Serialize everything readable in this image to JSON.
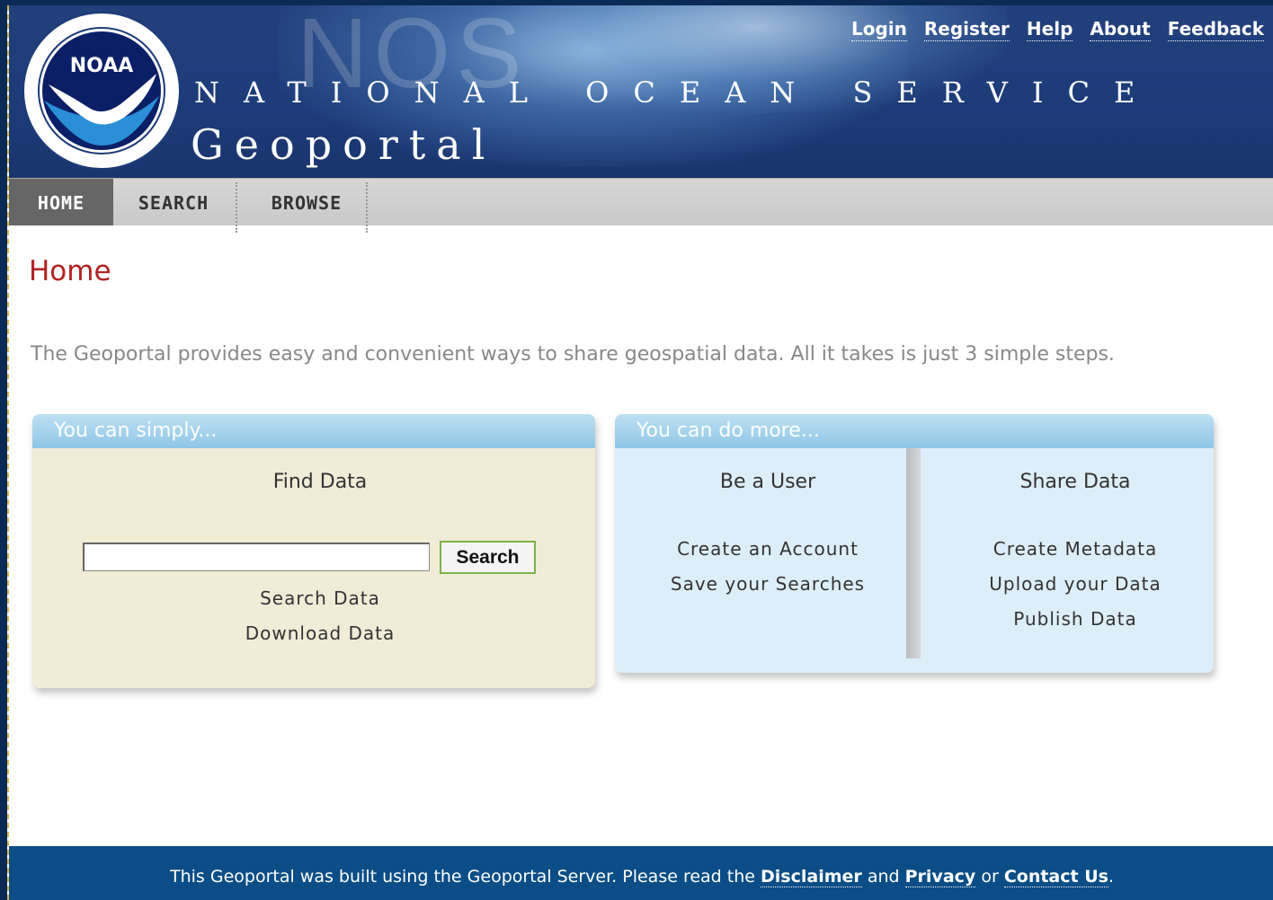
{
  "header": {
    "watermark": "NOS",
    "service_title": "NATIONAL OCEAN SERVICE",
    "portal_title": "Geoportal",
    "logo_text": "NOAA",
    "top_links": [
      "Login",
      "Register",
      "Help",
      "About",
      "Feedback"
    ]
  },
  "nav": {
    "tabs": [
      "HOME",
      "SEARCH",
      "BROWSE"
    ],
    "active": "HOME"
  },
  "main": {
    "page_title": "Home",
    "intro": "The Geoportal provides easy and convenient ways to share geospatial data. All it takes is just 3 simple steps.",
    "left_panel": {
      "heading": "You can simply...",
      "title": "Find Data",
      "search_value": "",
      "search_button": "Search",
      "links": [
        "Search Data",
        "Download Data"
      ]
    },
    "right_panel": {
      "heading": "You can do more...",
      "user_title": "Be a User",
      "user_links": [
        "Create an Account",
        "Save your Searches"
      ],
      "share_title": "Share Data",
      "share_links": [
        "Create Metadata",
        "Upload your Data",
        "Publish Data"
      ]
    }
  },
  "footer": {
    "text_before": "This Geoportal was built using the Geoportal Server. Please read the",
    "disclaimer": "Disclaimer",
    "and": "and",
    "privacy": "Privacy",
    "or": "or",
    "contact": "Contact Us",
    "end": "."
  },
  "colors": {
    "banner": "#1d3b78",
    "page_title": "#b22222",
    "footer": "#0b4d86",
    "left_panel": "#f1ecd6",
    "right_panel": "#dceef8"
  }
}
